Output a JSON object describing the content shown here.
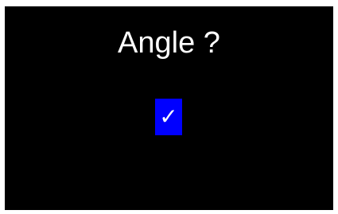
{
  "prompt": {
    "title": "Angle ?"
  },
  "confirm": {
    "icon": "check-icon",
    "glyph": "✓"
  },
  "colors": {
    "background": "#000000",
    "text": "#ffffff",
    "button": "#0000ff"
  }
}
